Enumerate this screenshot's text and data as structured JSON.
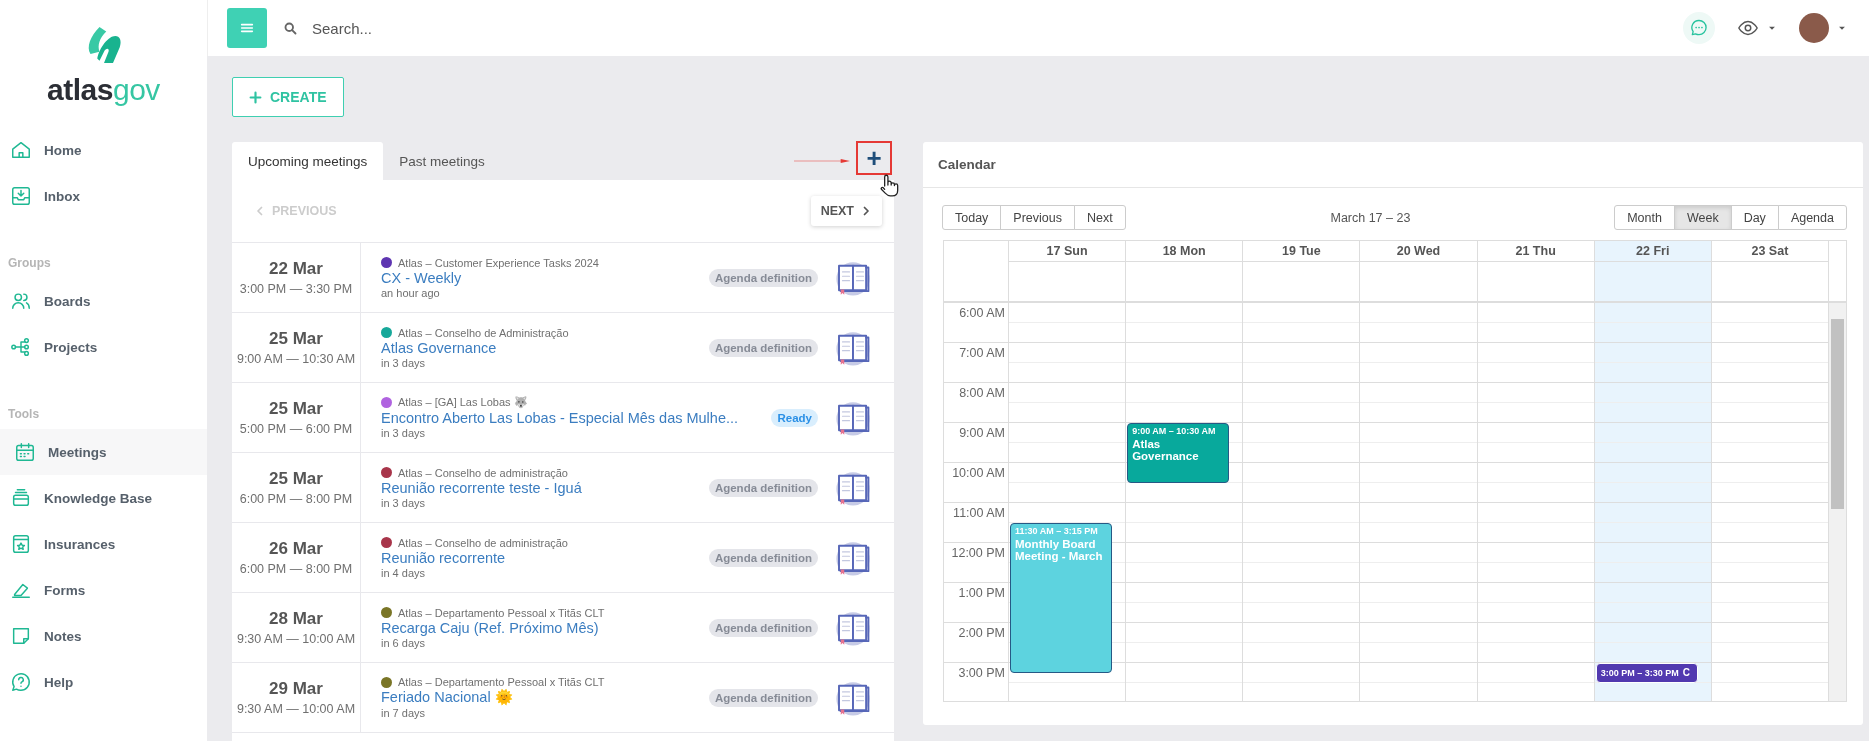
{
  "logo": {
    "text": "atlas",
    "accent": "gov"
  },
  "sidebar": {
    "sections": [
      {
        "items": [
          {
            "label": "Home",
            "selected": false
          },
          {
            "label": "Inbox",
            "selected": false
          }
        ]
      },
      {
        "label": "Groups",
        "items": [
          {
            "label": "Boards",
            "selected": false
          },
          {
            "label": "Projects",
            "selected": false
          }
        ]
      },
      {
        "label": "Tools",
        "items": [
          {
            "label": "Meetings",
            "selected": true
          },
          {
            "label": "Knowledge Base",
            "selected": false
          },
          {
            "label": "Insurances",
            "selected": false
          },
          {
            "label": "Forms",
            "selected": false
          },
          {
            "label": "Notes",
            "selected": false
          },
          {
            "label": "Help",
            "selected": false
          }
        ]
      }
    ]
  },
  "search": {
    "placeholder": "Search..."
  },
  "create_button": {
    "label": "CREATE"
  },
  "meetings": {
    "tabs": [
      {
        "label": "Upcoming meetings",
        "selected": true
      },
      {
        "label": "Past meetings",
        "selected": false
      }
    ],
    "add_button": {
      "label": "+"
    },
    "pager": {
      "previous": {
        "label": "PREVIOUS",
        "disabled": true
      },
      "next": {
        "label": "NEXT",
        "disabled": false
      }
    },
    "rows": [
      {
        "date": "22 Mar",
        "time": "3:00 PM — 3:30 PM",
        "group": "Atlas – Customer Experience Tasks 2024",
        "color": "#5e35b1",
        "title": "CX - Weekly",
        "relative": "an hour ago",
        "status": {
          "label": "Agenda definition",
          "kind": "agenda"
        }
      },
      {
        "date": "25 Mar",
        "time": "9:00 AM — 10:30 AM",
        "group": "Atlas – Conselho de Administração",
        "color": "#17a89a",
        "title": "Atlas Governance",
        "relative": "in 3 days",
        "status": {
          "label": "Agenda definition",
          "kind": "agenda"
        }
      },
      {
        "date": "25 Mar",
        "time": "5:00 PM — 6:00 PM",
        "group": "Atlas – [GA] Las Lobas 🐺",
        "color": "#b063e0",
        "title": "Encontro Aberto Las Lobas - Especial Mês das Mulhe...",
        "relative": "in 3 days",
        "status": {
          "label": "Ready",
          "kind": "ready"
        }
      },
      {
        "date": "25 Mar",
        "time": "6:00 PM — 8:00 PM",
        "group": "Atlas – Conselho de administração",
        "color": "#a8354a",
        "title": "Reunião recorrente teste - Iguá",
        "relative": "in 3 days",
        "status": {
          "label": "Agenda definition",
          "kind": "agenda"
        }
      },
      {
        "date": "26 Mar",
        "time": "6:00 PM — 8:00 PM",
        "group": "Atlas – Conselho de administração",
        "color": "#a8354a",
        "title": "Reunião recorrente",
        "relative": "in 4 days",
        "status": {
          "label": "Agenda definition",
          "kind": "agenda"
        }
      },
      {
        "date": "28 Mar",
        "time": "9:30 AM — 10:00 AM",
        "group": "Atlas – Departamento Pessoal x Titãs CLT",
        "color": "#7a7526",
        "title": "Recarga Caju (Ref. Próximo Mês)",
        "relative": "in 6 days",
        "status": {
          "label": "Agenda definition",
          "kind": "agenda"
        }
      },
      {
        "date": "29 Mar",
        "time": "9:30 AM — 10:00 AM",
        "group": "Atlas – Departamento Pessoal x Titãs CLT",
        "color": "#7a7526",
        "title": "Feriado Nacional 🌞",
        "relative": "in 7 days",
        "status": {
          "label": "Agenda definition",
          "kind": "agenda"
        }
      }
    ]
  },
  "calendar": {
    "title": "Calendar",
    "nav": [
      {
        "label": "Today"
      },
      {
        "label": "Previous"
      },
      {
        "label": "Next"
      }
    ],
    "range": "March 17 – 23",
    "views": [
      {
        "label": "Month",
        "selected": false
      },
      {
        "label": "Week",
        "selected": true
      },
      {
        "label": "Day",
        "selected": false
      },
      {
        "label": "Agenda",
        "selected": false
      }
    ],
    "hours": [
      "6:00 AM",
      "7:00 AM",
      "8:00 AM",
      "9:00 AM",
      "10:00 AM",
      "11:00 AM",
      "12:00 PM",
      "1:00 PM",
      "2:00 PM",
      "3:00 PM"
    ],
    "days": [
      {
        "label": "17 Sun",
        "today": false,
        "events": [
          {
            "time": "11:30 AM – 3:15 PM",
            "title": "Monthly Board Meeting - March",
            "color": "#5dd3df"
          }
        ]
      },
      {
        "label": "18 Mon",
        "today": false,
        "events": [
          {
            "time": "9:00 AM – 10:30 AM",
            "title": "Atlas Governance",
            "color": "#08a99c"
          }
        ]
      },
      {
        "label": "19 Tue",
        "today": false
      },
      {
        "label": "20 Wed",
        "today": false
      },
      {
        "label": "21 Thu",
        "today": false
      },
      {
        "label": "22 Fri",
        "today": true,
        "events": [
          {
            "time": "3:00 PM – 3:30 PM",
            "title": "C",
            "color": "#5139b0"
          }
        ]
      },
      {
        "label": "23 Sat",
        "today": false
      }
    ]
  }
}
